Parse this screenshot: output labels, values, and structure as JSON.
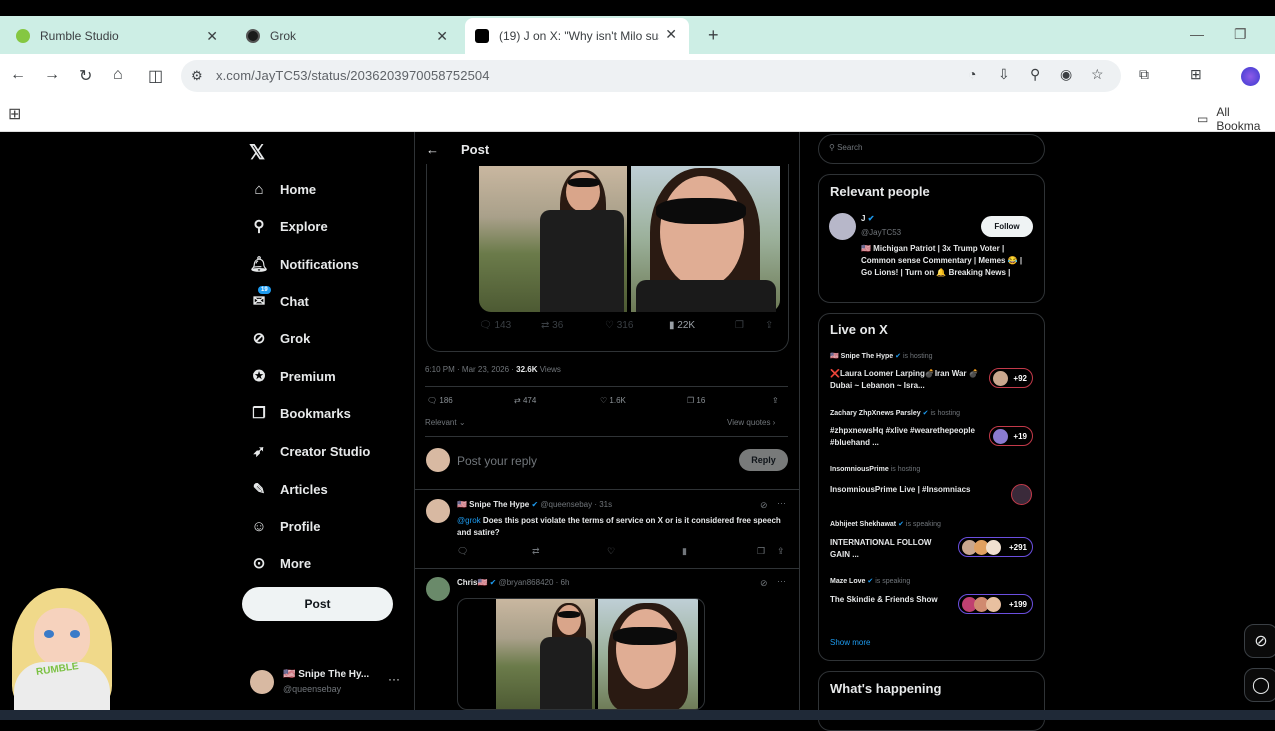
{
  "browser": {
    "tabs": [
      {
        "label": "Rumble Studio",
        "icon": "rumble-icon",
        "color": "#85c742"
      },
      {
        "label": "Grok",
        "icon": "grok-icon",
        "color": "#1a1a1a"
      },
      {
        "label": "(19) J on X: \"Why isn't Milo sus",
        "icon": "x-logo-icon",
        "color": "#000000"
      }
    ],
    "new_tab": "+",
    "url": "x.com/JayTC53/status/2036203970058752504",
    "bookmarks_label": "All Bookma"
  },
  "nav": {
    "logo": "𝕏",
    "items": [
      {
        "label": "Home",
        "icon": "home-icon",
        "glyph": "⌂"
      },
      {
        "label": "Explore",
        "icon": "search-icon",
        "glyph": "⚲"
      },
      {
        "label": "Notifications",
        "icon": "bell-icon",
        "glyph": "♫"
      },
      {
        "label": "Chat",
        "icon": "mail-icon",
        "glyph": "✉"
      },
      {
        "label": "Grok",
        "icon": "grok-icon",
        "glyph": "⊘"
      },
      {
        "label": "Premium",
        "icon": "premium-icon",
        "glyph": "✪"
      },
      {
        "label": "Bookmarks",
        "icon": "bookmark-icon",
        "glyph": "❐"
      },
      {
        "label": "Creator Studio",
        "icon": "rocket-icon",
        "glyph": "➶"
      },
      {
        "label": "Articles",
        "icon": "articles-icon",
        "glyph": "✎"
      },
      {
        "label": "Profile",
        "icon": "profile-icon",
        "glyph": "☺"
      },
      {
        "label": "More",
        "icon": "more-icon",
        "glyph": "⊙"
      }
    ],
    "chat_badge": "19",
    "post_button": "Post",
    "account_name": "🇺🇸 Snipe The Hy...",
    "account_handle": "@queensebay"
  },
  "post": {
    "header_title": "Post",
    "stats": {
      "replies": "143",
      "reposts": "36",
      "likes": "316",
      "views": "22K"
    },
    "timestamp": "6:10 PM · Mar 23, 2026 · ",
    "views_count": "32.6K",
    "views_label": " Views",
    "engagement": {
      "replies": "186",
      "reposts": "474",
      "likes": "1.6K",
      "bookmarks": "16"
    },
    "relevant_label": "Relevant",
    "view_quotes": "View quotes",
    "reply_placeholder": "Post your reply",
    "reply_button": "Reply"
  },
  "replies": [
    {
      "name": "🇺🇸 Snipe The Hype",
      "handle": "@queensebay · 31s",
      "mention": "@grok",
      "text": " Does this post violate the terms of service on X or is it considered free speech and satire?"
    },
    {
      "name": "Chris🇺🇸",
      "handle": "@bryan868420 · 6h"
    }
  ],
  "search": {
    "placeholder": "Search"
  },
  "relevant_people": {
    "title": "Relevant people",
    "name": "J",
    "handle": "@JayTC53",
    "follow": "Follow",
    "bio": "🇺🇸 Michigan Patriot | 3x Trump Voter | Common sense Commentary | Memes 😂 | Go Lions! | Turn on 🔔 Breaking News |"
  },
  "live": {
    "title": "Live on X",
    "items": [
      {
        "host": "🇺🇸 Snipe The Hype",
        "status": "is hosting",
        "title": "❌Laura Loomer Larping💣Iran War 💣 Dubai ~ Lebanon ~ Isra...",
        "count": "+92"
      },
      {
        "host": "Zachary ZhpXnews Parsley",
        "status": "is hosting",
        "title": "#zhpxnewsHq #xlive #wearethepeople #bluehand ...",
        "count": "+19"
      },
      {
        "host": "InsomniousPrime",
        "status": "is hosting",
        "title": "InsomniousPrime Live | #Insomniacs",
        "count": ""
      },
      {
        "host": "Abhijeet Shekhawat",
        "status": "is speaking",
        "title": "INTERNATIONAL FOLLOW GAIN ...",
        "count": "+291"
      },
      {
        "host": "Maze Love",
        "status": "is speaking",
        "title": "The Skindie & Friends Show",
        "count": "+199"
      }
    ],
    "show_more": "Show more"
  },
  "happening": {
    "title": "What's happening"
  },
  "overlay": {
    "badge": "RUMBLE"
  }
}
